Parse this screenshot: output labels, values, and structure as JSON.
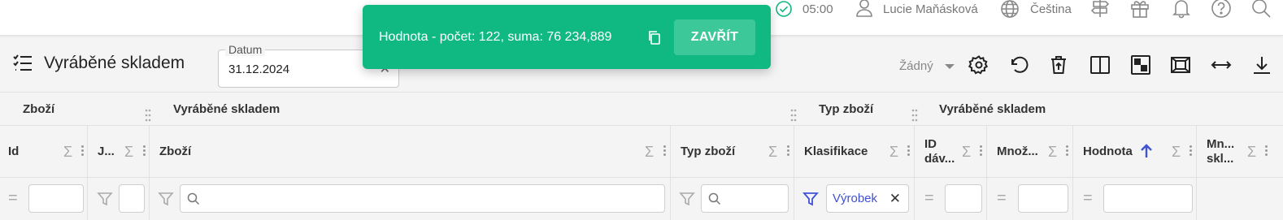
{
  "topbar": {
    "time": "05:00",
    "user": "Lucie Maňásková",
    "language": "Čeština",
    "icons": [
      "check-circle-icon",
      "user-icon",
      "globe-icon",
      "signpost-icon",
      "gift-icon",
      "bell-icon",
      "help-icon",
      "search-icon"
    ]
  },
  "page": {
    "title": "Vyráběné skladem",
    "date_field": {
      "label": "Datum",
      "value": "31.12.2024"
    },
    "view_select": "Žádný"
  },
  "toolbar": {
    "icons": [
      "settings-icon",
      "undo-icon",
      "delete-icon",
      "columns-icon",
      "checker-icon",
      "fit-icon",
      "resize-icon",
      "download-icon"
    ]
  },
  "grid": {
    "groups": [
      "Zboží",
      "Vyráběné skladem",
      "Typ zboží",
      "Vyráběné skladem"
    ],
    "columns": [
      "Id",
      "J...",
      "Zboží",
      "Typ zboží",
      "Klasifikace",
      "ID dáv...",
      "Množ...",
      "Hodnota",
      "Mn... skl..."
    ],
    "sigma": "Σ",
    "filter_chip": "Výrobek"
  },
  "toast": {
    "message": "Hodnota - počet: 122, suma: 76 234,889",
    "close_label": "ZAVŘÍT"
  },
  "colors": {
    "toast": "#10b981",
    "accent": "#3f51d8",
    "success": "#10b981"
  }
}
